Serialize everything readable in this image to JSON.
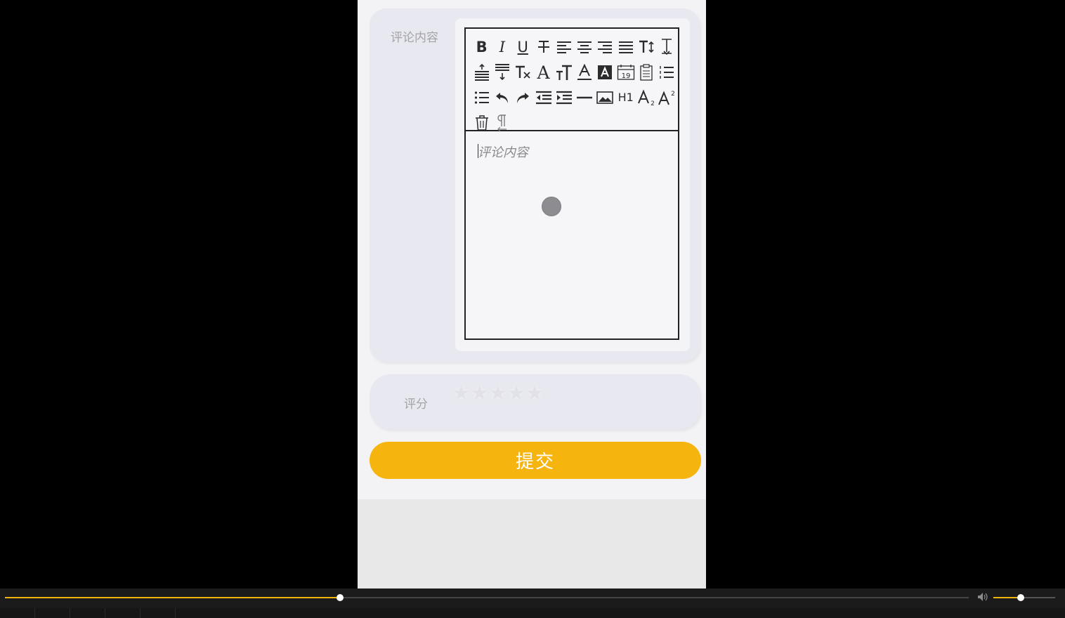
{
  "form": {
    "comment_label": "评论内容",
    "comment_placeholder": "评论内容",
    "rating_label": "评分",
    "rating": {
      "value": 0,
      "max": 5
    },
    "submit_label": "提交"
  },
  "toolbar": {
    "bold": "B",
    "italic": "I",
    "underline": "U",
    "h1": "H1"
  },
  "player": {
    "progress": 0.348,
    "volume": 0.44,
    "accent": "#f0b40c"
  },
  "colors": {
    "submit_bg": "#f6b40f",
    "label": "#a3a3a8"
  }
}
